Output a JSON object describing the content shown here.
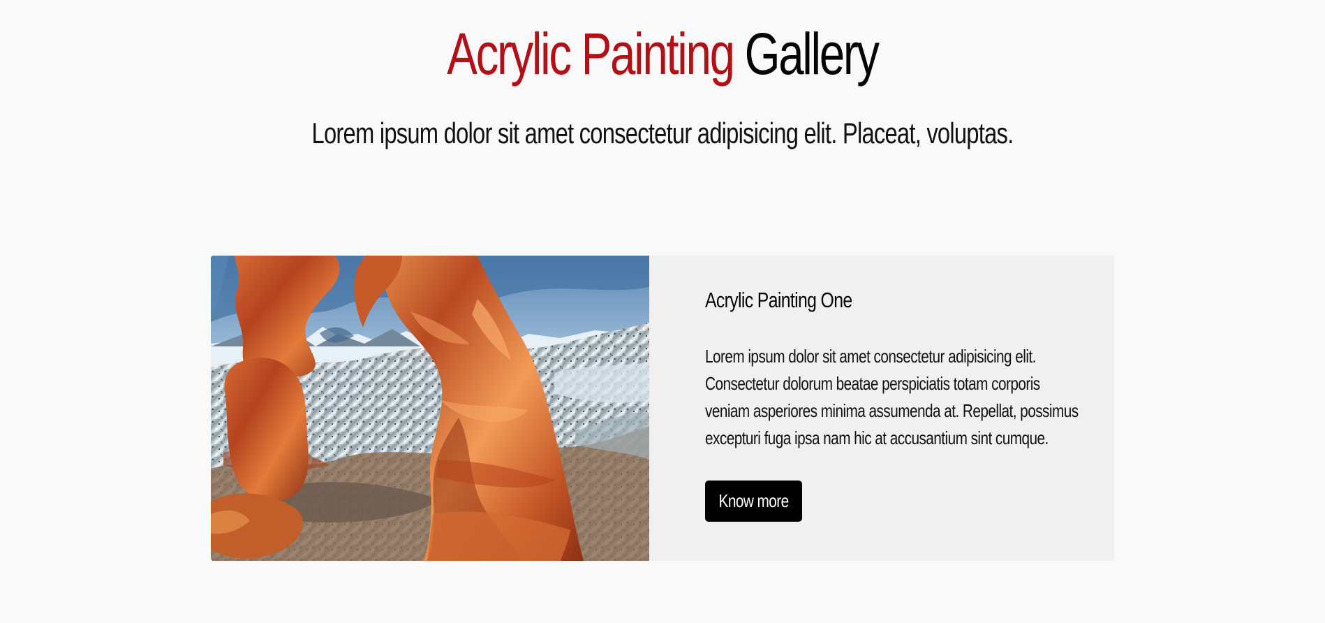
{
  "page": {
    "title": {
      "accent": "Acrylic Painting",
      "rest": "Gallery"
    },
    "subtitle": "Lorem ipsum dolor sit amet consectetur adipisicing elit. Placeat, voluptas."
  },
  "gallery": {
    "cards": [
      {
        "title": "Acrylic Painting One",
        "description": "Lorem ipsum dolor sit amet consectetur adipisicing elit. Consectetur dolorum beatae perspiciatis totam corporis veniam asperiores minima assumenda at. Repellat, possimus excepturi fuga ipsa nam hic at accusantium sint cumque.",
        "button_label": "Know more",
        "image_subject": "red rock arch landscape"
      }
    ]
  },
  "colors": {
    "accent": "#b21016",
    "background": "#f9f9f9",
    "card_background": "#f0f0f0",
    "button_background": "#000000",
    "button_text": "#ffffff"
  }
}
